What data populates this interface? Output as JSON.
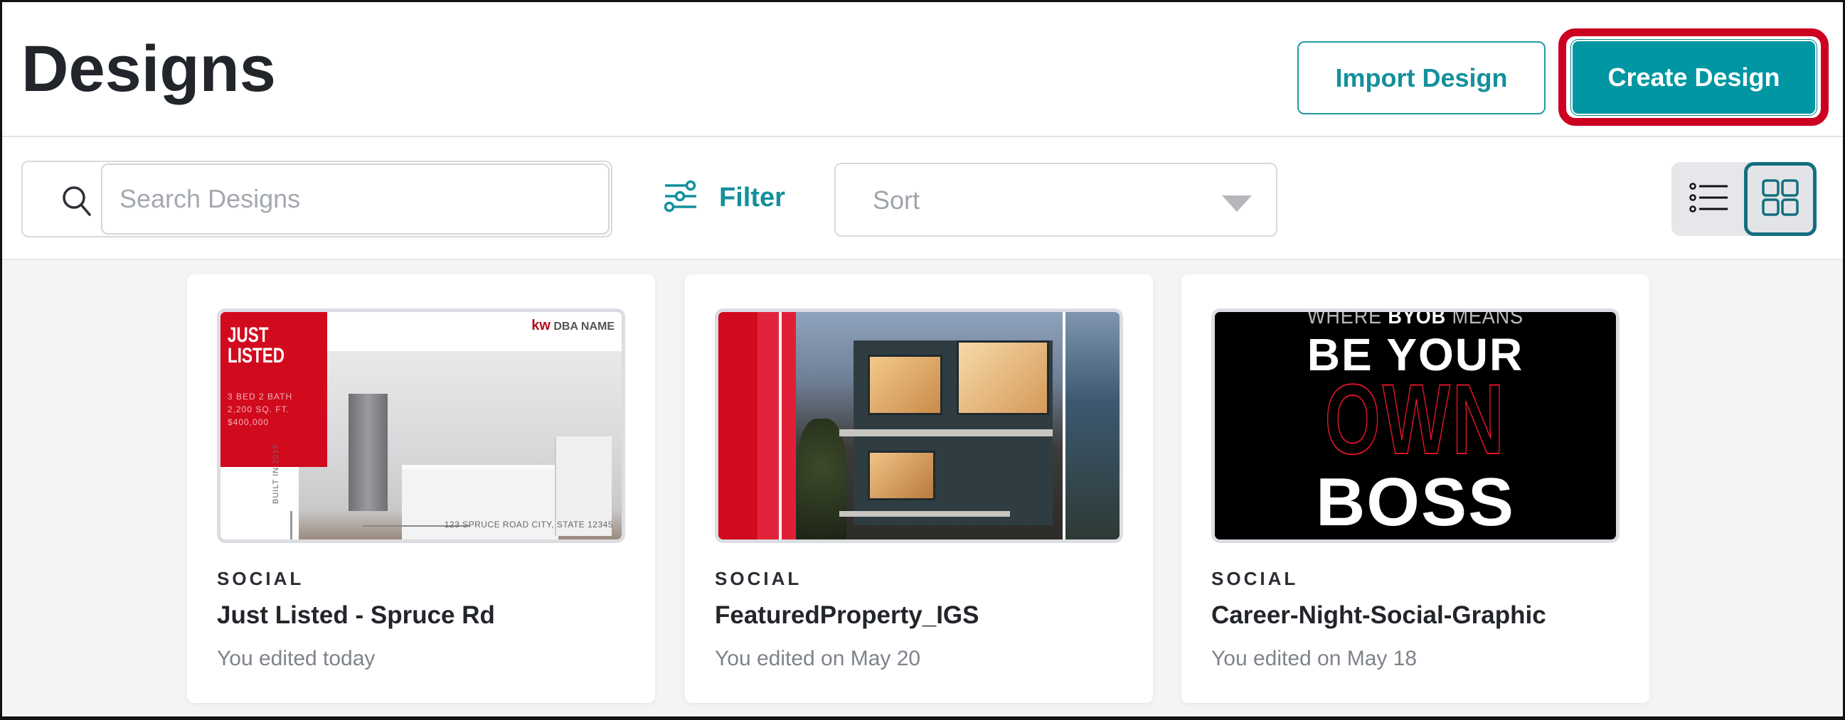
{
  "header": {
    "title": "Designs",
    "import_label": "Import Design",
    "create_label": "Create Design"
  },
  "toolbar": {
    "search": {
      "placeholder": "Search Designs",
      "value": ""
    },
    "filter_label": "Filter",
    "sort": {
      "placeholder": "Sort",
      "selected": ""
    },
    "view_modes": [
      "list",
      "grid"
    ],
    "active_view": "grid"
  },
  "colors": {
    "accent": "#0097a3",
    "highlight": "#cc0020",
    "brand_red": "#d10a1e"
  },
  "designs": [
    {
      "category": "SOCIAL",
      "title": "Just Listed - Spruce Rd",
      "edited": "You edited today",
      "thumbnail": {
        "headline": "JUST LISTED",
        "details": [
          "3 BED 2 BATH",
          "2,200 SQ. FT.",
          "$400,000"
        ],
        "logo_mark": "kw",
        "logo_text": "DBA NAME",
        "side_text": "BUILT IN 2015",
        "address": "123 SPRUCE ROAD CITY, STATE 12345"
      }
    },
    {
      "category": "SOCIAL",
      "title": "FeaturedProperty_IGS",
      "edited": "You edited on May 20",
      "thumbnail": {}
    },
    {
      "category": "SOCIAL",
      "title": "Career-Night-Social-Graphic",
      "edited": "You edited on May 18",
      "thumbnail": {
        "line1_light": "WHERE",
        "line1_bold": "BYOB",
        "line1_end": "MEANS",
        "line2": "BE YOUR",
        "line3": "OWN",
        "line4": "BOSS"
      }
    }
  ]
}
